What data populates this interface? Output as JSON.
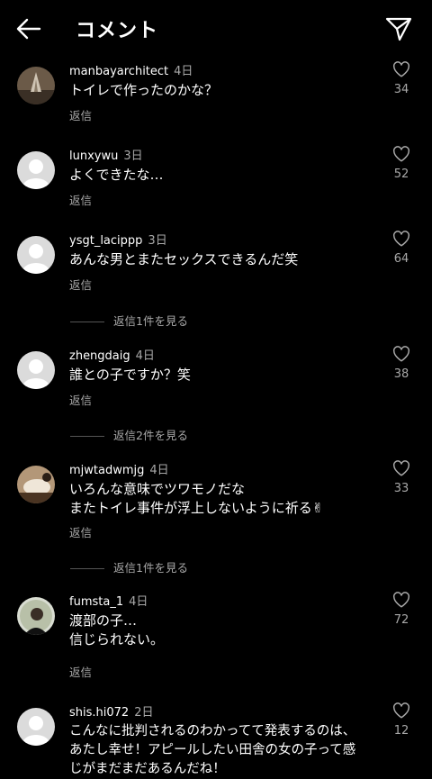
{
  "header": {
    "title": "コメント"
  },
  "reply_label": "返信",
  "comments": [
    {
      "username": "manbayarchitect",
      "time": "4日",
      "text": "トイレで作ったのかな？",
      "likes": "34"
    },
    {
      "username": "lunxywu",
      "time": "3日",
      "text": "よくできたな…",
      "likes": "52"
    },
    {
      "username": "ysgt_lacippp",
      "time": "3日",
      "text": "あんな男とまたセックスできるんだ笑",
      "likes": "64"
    },
    {
      "username": "zhengdaig",
      "time": "4日",
      "text": "誰との子ですか？笑",
      "likes": "38"
    },
    {
      "username": "mjwtadwmjg",
      "time": "4日",
      "text_line1": "いろんな意味でツワモノだな",
      "text_line2": "またトイレ事件が浮上しないように祈る✌",
      "likes": "33"
    },
    {
      "username": "fumsta_1",
      "time": "4日",
      "text_line1": "渡部の子…",
      "text_line2": "信じられない。",
      "likes": "72"
    },
    {
      "username": "shis.hi072",
      "time": "2日",
      "text_line1": "こんなに批判されるのわかってて発表するのは、",
      "text_line2": "あたし幸せ！アピールしたい田舎の女の子って感",
      "text_line3": "じがまだまだあるんだね！",
      "likes": "12"
    }
  ],
  "view_replies": [
    "返信1件を見る",
    "返信2件を見る",
    "返信1件を見る"
  ],
  "colors": {
    "background": "#000000",
    "text": "#ffffff",
    "secondary": "#a8a8a8",
    "avatar_default": "#dbdbdb"
  }
}
